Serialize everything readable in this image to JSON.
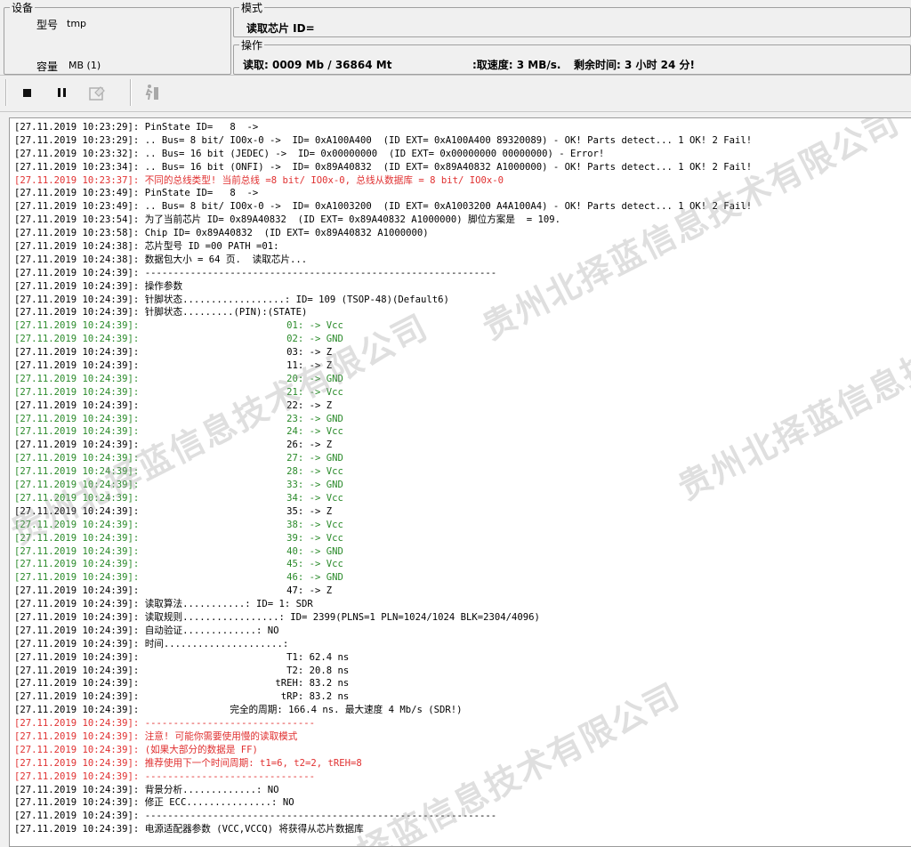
{
  "device": {
    "group_title": "设备",
    "model_label": "型号",
    "model_value": "tmp",
    "capacity_label": "容量",
    "capacity_value": "MB (1)"
  },
  "mode": {
    "group_title": "模式",
    "value": "读取芯片 ID="
  },
  "operation": {
    "group_title": "操作",
    "read_progress": "读取: 0009 Mb / 36864 Mt",
    "read_speed": ":取速度: 3 MB/s.",
    "remaining": "剩余时间: 3 小时 24 分!"
  },
  "toolbar": {
    "buttons": [
      {
        "name": "stop-button",
        "icon": "stop-icon",
        "enabled": true
      },
      {
        "name": "pause-button",
        "icon": "pause-icon",
        "enabled": true
      },
      {
        "name": "save-button",
        "icon": "save-icon",
        "enabled": false
      },
      {
        "name": "run-button",
        "icon": "runner-icon",
        "enabled": false
      }
    ]
  },
  "colors": {
    "error": "#e03030",
    "ok": "#2a8a2a",
    "normal": "#000000"
  },
  "log": [
    {
      "t": "[27.11.2019 10:23:29]: PinState ID=   8  ->",
      "c": "normal"
    },
    {
      "t": "[27.11.2019 10:23:29]: .. Bus= 8 bit/ IO0x-0 ->  ID= 0xA100A400  (ID EXT= 0xA100A400 89320089) - OK! Parts detect... 1 OK! 2 Fail!",
      "c": "normal"
    },
    {
      "t": "[27.11.2019 10:23:32]: .. Bus= 16 bit (JEDEC) ->  ID= 0x00000000  (ID EXT= 0x00000000 00000000) - Error!",
      "c": "normal"
    },
    {
      "t": "[27.11.2019 10:23:34]: .. Bus= 16 bit (ONFI) ->  ID= 0x89A40832  (ID EXT= 0x89A40832 A1000000) - OK! Parts detect... 1 OK! 2 Fail!",
      "c": "normal"
    },
    {
      "t": "[27.11.2019 10:23:37]: 不同的总线类型! 当前总线 =8 bit/ IO0x-0, 总线从数据库 = 8 bit/ IO0x-0",
      "c": "red"
    },
    {
      "t": "[27.11.2019 10:23:49]: PinState ID=   8  ->",
      "c": "normal"
    },
    {
      "t": "[27.11.2019 10:23:49]: .. Bus= 8 bit/ IO0x-0 ->  ID= 0xA1003200  (ID EXT= 0xA1003200 A4A100A4) - OK! Parts detect... 1 OK! 2 Fail!",
      "c": "normal"
    },
    {
      "t": "[27.11.2019 10:23:54]: 为了当前芯片 ID= 0x89A40832  (ID EXT= 0x89A40832 A1000000) 脚位方案是  = 109.",
      "c": "normal"
    },
    {
      "t": "[27.11.2019 10:23:58]: Chip ID= 0x89A40832  (ID EXT= 0x89A40832 A1000000)",
      "c": "normal"
    },
    {
      "t": "[27.11.2019 10:24:38]: 芯片型号 ID =00 PATH =01:",
      "c": "normal"
    },
    {
      "t": "[27.11.2019 10:24:38]: 数据包大小 = 64 页.  读取芯片...",
      "c": "normal"
    },
    {
      "t": "[27.11.2019 10:24:39]: --------------------------------------------------------------",
      "c": "normal"
    },
    {
      "t": "[27.11.2019 10:24:39]: 操作参数",
      "c": "normal"
    },
    {
      "t": "[27.11.2019 10:24:39]: 针脚状态..................: ID= 109 (TSOP-48)(Default6)",
      "c": "normal"
    },
    {
      "t": "[27.11.2019 10:24:39]: 针脚状态.........(PIN):(STATE)",
      "c": "normal"
    },
    {
      "t": "[27.11.2019 10:24:39]:                          01: -> Vcc",
      "c": "green"
    },
    {
      "t": "[27.11.2019 10:24:39]:                          02: -> GND",
      "c": "green"
    },
    {
      "t": "[27.11.2019 10:24:39]:                          03: -> Z",
      "c": "normal"
    },
    {
      "t": "[27.11.2019 10:24:39]:                          11: -> Z",
      "c": "normal"
    },
    {
      "t": "[27.11.2019 10:24:39]:                          20: -> GND",
      "c": "green"
    },
    {
      "t": "[27.11.2019 10:24:39]:                          21: -> Vcc",
      "c": "green"
    },
    {
      "t": "[27.11.2019 10:24:39]:                          22: -> Z",
      "c": "normal"
    },
    {
      "t": "[27.11.2019 10:24:39]:                          23: -> GND",
      "c": "green"
    },
    {
      "t": "[27.11.2019 10:24:39]:                          24: -> Vcc",
      "c": "green"
    },
    {
      "t": "[27.11.2019 10:24:39]:                          26: -> Z",
      "c": "normal"
    },
    {
      "t": "[27.11.2019 10:24:39]:                          27: -> GND",
      "c": "green"
    },
    {
      "t": "[27.11.2019 10:24:39]:                          28: -> Vcc",
      "c": "green"
    },
    {
      "t": "[27.11.2019 10:24:39]:                          33: -> GND",
      "c": "green"
    },
    {
      "t": "[27.11.2019 10:24:39]:                          34: -> Vcc",
      "c": "green"
    },
    {
      "t": "[27.11.2019 10:24:39]:                          35: -> Z",
      "c": "normal"
    },
    {
      "t": "[27.11.2019 10:24:39]:                          38: -> Vcc",
      "c": "green"
    },
    {
      "t": "[27.11.2019 10:24:39]:                          39: -> Vcc",
      "c": "green"
    },
    {
      "t": "[27.11.2019 10:24:39]:                          40: -> GND",
      "c": "green"
    },
    {
      "t": "[27.11.2019 10:24:39]:                          45: -> Vcc",
      "c": "green"
    },
    {
      "t": "[27.11.2019 10:24:39]:                          46: -> GND",
      "c": "green"
    },
    {
      "t": "[27.11.2019 10:24:39]:                          47: -> Z",
      "c": "normal"
    },
    {
      "t": "[27.11.2019 10:24:39]: 读取算法...........: ID= 1: SDR",
      "c": "normal"
    },
    {
      "t": "[27.11.2019 10:24:39]: 读取规则.................: ID= 2399(PLNS=1 PLN=1024/1024 BLK=2304/4096)",
      "c": "normal"
    },
    {
      "t": "[27.11.2019 10:24:39]: 自动验证.............: NO",
      "c": "normal"
    },
    {
      "t": "[27.11.2019 10:24:39]: 时间.....................:",
      "c": "normal"
    },
    {
      "t": "[27.11.2019 10:24:39]:                          T1: 62.4 ns",
      "c": "normal"
    },
    {
      "t": "[27.11.2019 10:24:39]:                          T2: 20.8 ns",
      "c": "normal"
    },
    {
      "t": "[27.11.2019 10:24:39]:                        tREH: 83.2 ns",
      "c": "normal"
    },
    {
      "t": "[27.11.2019 10:24:39]:                         tRP: 83.2 ns",
      "c": "normal"
    },
    {
      "t": "[27.11.2019 10:24:39]:                完全的周期: 166.4 ns. 最大速度 4 Mb/s (SDR!)",
      "c": "normal"
    },
    {
      "t": "[27.11.2019 10:24:39]: ------------------------------",
      "c": "red"
    },
    {
      "t": "[27.11.2019 10:24:39]: 注意! 可能你需要使用慢的读取模式",
      "c": "red"
    },
    {
      "t": "[27.11.2019 10:24:39]: (如果大部分的数据是 FF)",
      "c": "red"
    },
    {
      "t": "[27.11.2019 10:24:39]: 推荐使用下一个时间周期: t1=6, t2=2, tREH=8",
      "c": "red"
    },
    {
      "t": "[27.11.2019 10:24:39]: ------------------------------",
      "c": "red"
    },
    {
      "t": "[27.11.2019 10:24:39]: 背景分析.............: NO",
      "c": "normal"
    },
    {
      "t": "[27.11.2019 10:24:39]: 修正 ECC...............: NO",
      "c": "normal"
    },
    {
      "t": "[27.11.2019 10:24:39]: --------------------------------------------------------------",
      "c": "normal"
    },
    {
      "t": "[27.11.2019 10:24:39]: 电源适配器参数 (VCC,VCCQ) 将获得从芯片数据库",
      "c": "normal"
    }
  ],
  "watermarks": [
    "贵州北择蓝信息技术有限公司",
    "贵州北择蓝信息技术有限公司",
    "贵州北择蓝信息技术有限公司",
    "择蓝信息技术有限公司"
  ]
}
